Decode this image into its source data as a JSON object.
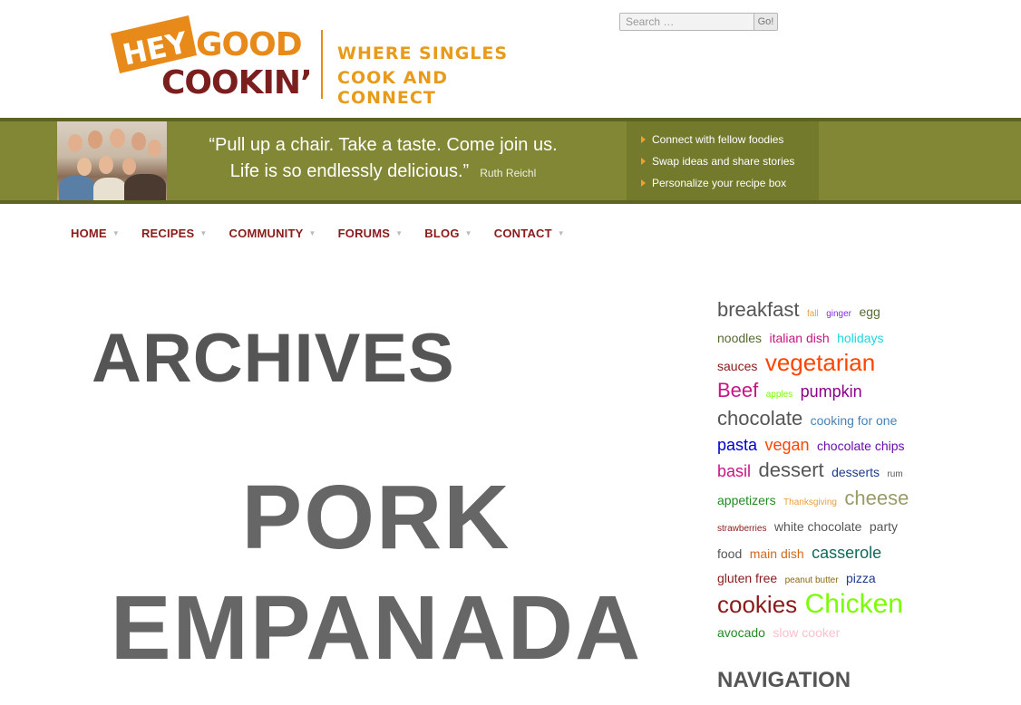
{
  "logo": {
    "hey": "HEY",
    "good": "GOOD",
    "cookin": "COOKIN’",
    "tagline_1": "WHERE SINGLES",
    "tagline_2": "COOK AND CONNECT",
    "colors": {
      "orange": "#e88a1a",
      "maroon": "#7a1e1e"
    }
  },
  "search": {
    "placeholder": "Search …",
    "button_label": "Go!"
  },
  "banner": {
    "quote_line_1": "“Pull up a chair. Take a taste. Come join us.",
    "quote_line_2": "Life is so endlessly delicious.”",
    "quote_author": "Ruth Reichl",
    "items": [
      {
        "label": "Connect with fellow foodies"
      },
      {
        "label": "Swap ideas and share stories"
      },
      {
        "label": "Personalize your recipe box"
      }
    ],
    "colors": {
      "background": "#818734",
      "list_background": "#737a2c",
      "bullet": "#f0a030"
    }
  },
  "nav": {
    "items": [
      {
        "label": "HOME",
        "icon": "caret-down-icon"
      },
      {
        "label": "RECIPES",
        "icon": "caret-down-icon"
      },
      {
        "label": "COMMUNITY",
        "icon": "caret-down-icon"
      },
      {
        "label": "FORUMS",
        "icon": "caret-down-icon"
      },
      {
        "label": "BLOG",
        "icon": "caret-down-icon"
      },
      {
        "label": "CONTACT",
        "icon": "caret-down-icon"
      }
    ],
    "color": "#8b1a1a"
  },
  "main": {
    "archives_heading": "ARCHIVES",
    "post_title": "PORK EMPANADA"
  },
  "sidebar": {
    "tags": [
      {
        "label": "breakfast",
        "color": "#555555",
        "size": "large"
      },
      {
        "label": "fall",
        "color": "#e8a040",
        "size": "tiny"
      },
      {
        "label": "ginger",
        "color": "#8a2be2",
        "size": "tiny"
      },
      {
        "label": "egg",
        "color": "#556b2f",
        "size": "small"
      },
      {
        "label": "noodles",
        "color": "#556b2f",
        "size": "small"
      },
      {
        "label": "italian dish",
        "color": "#c71585",
        "size": "small"
      },
      {
        "label": "holidays",
        "color": "#1fd5e0",
        "size": "small"
      },
      {
        "label": "sauces",
        "color": "#8b1a1a",
        "size": "small"
      },
      {
        "label": "vegetarian",
        "color": "#ff4500",
        "size": "xlarge"
      },
      {
        "label": "Beef",
        "color": "#c71585",
        "size": "large"
      },
      {
        "label": "apples",
        "color": "#7cfc00",
        "size": "tiny"
      },
      {
        "label": "pumpkin",
        "color": "#8b008b",
        "size": "medium"
      },
      {
        "label": "chocolate",
        "color": "#555555",
        "size": "large"
      },
      {
        "label": "cooking for one",
        "color": "#4682b4",
        "size": "small"
      },
      {
        "label": "pasta",
        "color": "#0000cd",
        "size": "medium"
      },
      {
        "label": "vegan",
        "color": "#ff4500",
        "size": "medium"
      },
      {
        "label": "chocolate chips",
        "color": "#6a0dad",
        "size": "small"
      },
      {
        "label": "basil",
        "color": "#c71585",
        "size": "medium"
      },
      {
        "label": "dessert",
        "color": "#555555",
        "size": "large"
      },
      {
        "label": "desserts",
        "color": "#1e3a8a",
        "size": "small"
      },
      {
        "label": "rum",
        "color": "#555555",
        "size": "tiny"
      },
      {
        "label": "appetizers",
        "color": "#228b22",
        "size": "small"
      },
      {
        "label": "Thanksgiving",
        "color": "#e8a040",
        "size": "tiny"
      },
      {
        "label": "cheese",
        "color": "#9b9b6a",
        "size": "large"
      },
      {
        "label": "strawberries",
        "color": "#8b1a1a",
        "size": "tiny"
      },
      {
        "label": "white chocolate",
        "color": "#555555",
        "size": "small"
      },
      {
        "label": "party food",
        "color": "#555555",
        "size": "small"
      },
      {
        "label": "main dish",
        "color": "#d2691e",
        "size": "small"
      },
      {
        "label": "casserole",
        "color": "#0f6b5b",
        "size": "medium"
      },
      {
        "label": "gluten free",
        "color": "#8b1a1a",
        "size": "small"
      },
      {
        "label": "peanut butter",
        "color": "#8b6914",
        "size": "tiny"
      },
      {
        "label": "pizza",
        "color": "#1e3a8a",
        "size": "small"
      },
      {
        "label": "cookies",
        "color": "#8b1a1a",
        "size": "xlarge"
      },
      {
        "label": "Chicken",
        "color": "#7cfc00",
        "size": "xxlarge"
      },
      {
        "label": "avocado",
        "color": "#228b22",
        "size": "small"
      },
      {
        "label": "slow cooker",
        "color": "#ffc0cb",
        "size": "small"
      }
    ],
    "navigation_heading": "NAVIGATION"
  }
}
